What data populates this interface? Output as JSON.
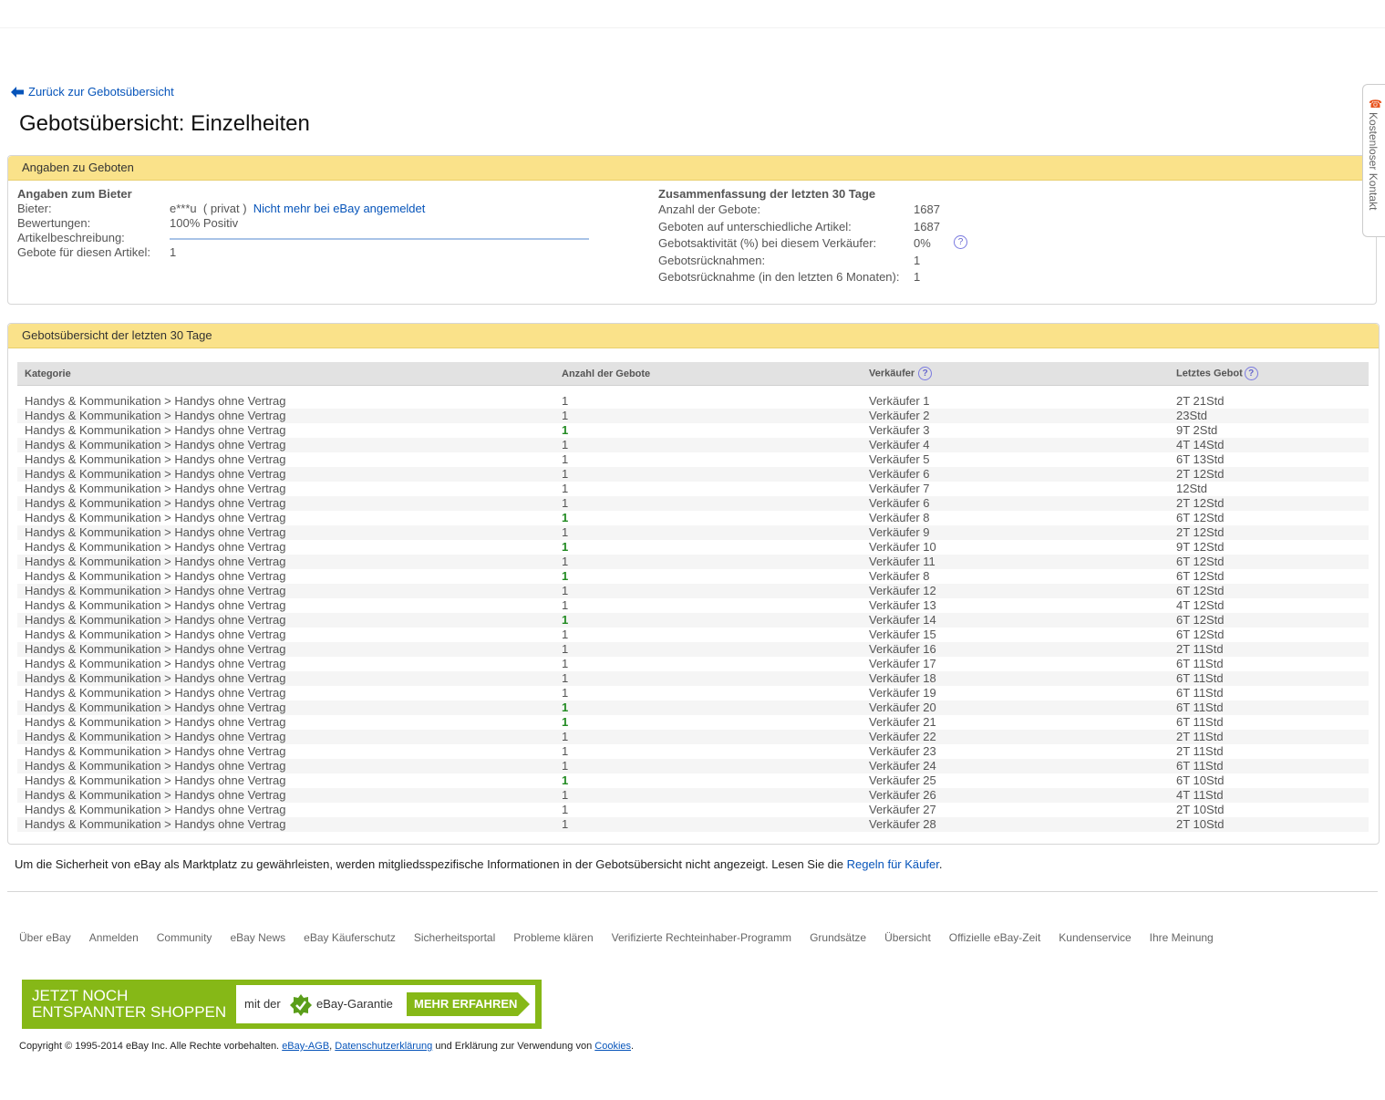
{
  "back_link": {
    "label": "Zurück zur Gebotsübersicht"
  },
  "page_title": "Gebotsübersicht: Einzelheiten",
  "info_panel": {
    "header": "Angaben zu Geboten",
    "bidder": {
      "heading": "Angaben zum Bieter",
      "bidder_label": "Bieter:",
      "bidder_name": "e***u",
      "bidder_type": "( privat )",
      "bidder_status_link": "Nicht mehr bei eBay angemeldet",
      "ratings_label": "Bewertungen:",
      "ratings_value": "100% Positiv",
      "description_label": "Artikelbeschreibung:",
      "bids_item_label": "Gebote für diesen Artikel:",
      "bids_item_value": "1"
    },
    "summary": {
      "heading": "Zusammenfassung der letzten 30 Tage",
      "rows": [
        {
          "label": "Anzahl der Gebote:",
          "value": "1687"
        },
        {
          "label": "Geboten auf unterschiedliche Artikel:",
          "value": "1687"
        },
        {
          "label": "Gebotsaktivität (%) bei diesem Verkäufer:",
          "value": "0%"
        },
        {
          "label": "Gebotsrücknahmen:",
          "value": "1"
        },
        {
          "label": "Gebotsrücknahme (in den letzten 6 Monaten):",
          "value": "1"
        }
      ]
    }
  },
  "history_panel": {
    "header": "Gebotsübersicht der letzten 30 Tage",
    "columns": [
      "Kategorie",
      "Anzahl der Gebote",
      "Verkäufer",
      "Letztes Gebot"
    ],
    "rows": [
      {
        "category": "Handys & Kommunikation > Handys ohne Vertrag",
        "bids": "1",
        "highlight": false,
        "seller": "Verkäufer 1",
        "last_bid": "2T 21Std"
      },
      {
        "category": "Handys & Kommunikation > Handys ohne Vertrag",
        "bids": "1",
        "highlight": false,
        "seller": "Verkäufer 2",
        "last_bid": "23Std"
      },
      {
        "category": "Handys & Kommunikation > Handys ohne Vertrag",
        "bids": "1",
        "highlight": true,
        "seller": "Verkäufer 3",
        "last_bid": "9T 2Std"
      },
      {
        "category": "Handys & Kommunikation > Handys ohne Vertrag",
        "bids": "1",
        "highlight": false,
        "seller": "Verkäufer 4",
        "last_bid": "4T 14Std"
      },
      {
        "category": "Handys & Kommunikation > Handys ohne Vertrag",
        "bids": "1",
        "highlight": false,
        "seller": "Verkäufer 5",
        "last_bid": "6T 13Std"
      },
      {
        "category": "Handys & Kommunikation > Handys ohne Vertrag",
        "bids": "1",
        "highlight": false,
        "seller": "Verkäufer 6",
        "last_bid": "2T 12Std"
      },
      {
        "category": "Handys & Kommunikation > Handys ohne Vertrag",
        "bids": "1",
        "highlight": false,
        "seller": "Verkäufer 7",
        "last_bid": "12Std"
      },
      {
        "category": "Handys & Kommunikation > Handys ohne Vertrag",
        "bids": "1",
        "highlight": false,
        "seller": "Verkäufer 6",
        "last_bid": "2T 12Std"
      },
      {
        "category": "Handys & Kommunikation > Handys ohne Vertrag",
        "bids": "1",
        "highlight": true,
        "seller": "Verkäufer 8",
        "last_bid": "6T 12Std"
      },
      {
        "category": "Handys & Kommunikation > Handys ohne Vertrag",
        "bids": "1",
        "highlight": false,
        "seller": "Verkäufer 9",
        "last_bid": "2T 12Std"
      },
      {
        "category": "Handys & Kommunikation > Handys ohne Vertrag",
        "bids": "1",
        "highlight": true,
        "seller": "Verkäufer 10",
        "last_bid": "9T 12Std"
      },
      {
        "category": "Handys & Kommunikation > Handys ohne Vertrag",
        "bids": "1",
        "highlight": false,
        "seller": "Verkäufer 11",
        "last_bid": "6T 12Std"
      },
      {
        "category": "Handys & Kommunikation > Handys ohne Vertrag",
        "bids": "1",
        "highlight": true,
        "seller": "Verkäufer 8",
        "last_bid": "6T 12Std"
      },
      {
        "category": "Handys & Kommunikation > Handys ohne Vertrag",
        "bids": "1",
        "highlight": false,
        "seller": "Verkäufer 12",
        "last_bid": "6T 12Std"
      },
      {
        "category": "Handys & Kommunikation > Handys ohne Vertrag",
        "bids": "1",
        "highlight": false,
        "seller": "Verkäufer 13",
        "last_bid": "4T 12Std"
      },
      {
        "category": "Handys & Kommunikation > Handys ohne Vertrag",
        "bids": "1",
        "highlight": true,
        "seller": "Verkäufer 14",
        "last_bid": "6T 12Std"
      },
      {
        "category": "Handys & Kommunikation > Handys ohne Vertrag",
        "bids": "1",
        "highlight": false,
        "seller": "Verkäufer 15",
        "last_bid": "6T 12Std"
      },
      {
        "category": "Handys & Kommunikation > Handys ohne Vertrag",
        "bids": "1",
        "highlight": false,
        "seller": "Verkäufer 16",
        "last_bid": "2T 11Std"
      },
      {
        "category": "Handys & Kommunikation > Handys ohne Vertrag",
        "bids": "1",
        "highlight": false,
        "seller": "Verkäufer 17",
        "last_bid": "6T 11Std"
      },
      {
        "category": "Handys & Kommunikation > Handys ohne Vertrag",
        "bids": "1",
        "highlight": false,
        "seller": "Verkäufer 18",
        "last_bid": "6T 11Std"
      },
      {
        "category": "Handys & Kommunikation > Handys ohne Vertrag",
        "bids": "1",
        "highlight": false,
        "seller": "Verkäufer 19",
        "last_bid": "6T 11Std"
      },
      {
        "category": "Handys & Kommunikation > Handys ohne Vertrag",
        "bids": "1",
        "highlight": true,
        "seller": "Verkäufer 20",
        "last_bid": "6T 11Std"
      },
      {
        "category": "Handys & Kommunikation > Handys ohne Vertrag",
        "bids": "1",
        "highlight": true,
        "seller": "Verkäufer 21",
        "last_bid": "6T 11Std"
      },
      {
        "category": "Handys & Kommunikation > Handys ohne Vertrag",
        "bids": "1",
        "highlight": false,
        "seller": "Verkäufer 22",
        "last_bid": "2T 11Std"
      },
      {
        "category": "Handys & Kommunikation > Handys ohne Vertrag",
        "bids": "1",
        "highlight": false,
        "seller": "Verkäufer 23",
        "last_bid": "2T 11Std"
      },
      {
        "category": "Handys & Kommunikation > Handys ohne Vertrag",
        "bids": "1",
        "highlight": false,
        "seller": "Verkäufer 24",
        "last_bid": "6T 11Std"
      },
      {
        "category": "Handys & Kommunikation > Handys ohne Vertrag",
        "bids": "1",
        "highlight": true,
        "seller": "Verkäufer 25",
        "last_bid": "6T 10Std"
      },
      {
        "category": "Handys & Kommunikation > Handys ohne Vertrag",
        "bids": "1",
        "highlight": false,
        "seller": "Verkäufer 26",
        "last_bid": "4T 11Std"
      },
      {
        "category": "Handys & Kommunikation > Handys ohne Vertrag",
        "bids": "1",
        "highlight": false,
        "seller": "Verkäufer 27",
        "last_bid": "2T 10Std"
      },
      {
        "category": "Handys & Kommunikation > Handys ohne Vertrag",
        "bids": "1",
        "highlight": false,
        "seller": "Verkäufer 28",
        "last_bid": "2T 10Std"
      }
    ]
  },
  "security_note": {
    "text": "Um die Sicherheit von eBay als Marktplatz zu gewährleisten, werden mitgliedsspezifische Informationen in der Gebotsübersicht nicht angezeigt. Lesen Sie die ",
    "link": "Regeln für Käufer",
    "end": "."
  },
  "footer_links": [
    "Über eBay",
    "Anmelden",
    "Community",
    "eBay News",
    "eBay Käuferschutz",
    "Sicherheitsportal",
    "Probleme klären",
    "Verifizierte Rechteinhaber-Programm",
    "Grundsätze",
    "Übersicht",
    "Offizielle eBay-Zeit",
    "Kundenservice",
    "Ihre Meinung"
  ],
  "banner": {
    "line1": "Jetzt noch",
    "line2": "entspannter shoppen",
    "mit_der": "mit der",
    "garantie": "eBay-Garantie",
    "button": "MEHR ERFAHREN",
    "icon": "star-check-icon"
  },
  "copyright": {
    "prefix": "Copyright © 1995-2014 eBay Inc. Alle Rechte vorbehalten.",
    "agb": "eBay-AGB",
    "comma": ",",
    "datenschutz": "Datenschutzerklärung",
    "middle": "und Erklärung zur Verwendung von",
    "cookies": "Cookies",
    "end": "."
  },
  "side_tab": {
    "label": "Kostenloser Kontakt",
    "icon": "phone-icon"
  },
  "colors": {
    "accent": "#fae28a",
    "link": "#0654ba",
    "banner": "#86b817",
    "highlight": "#228b22"
  }
}
